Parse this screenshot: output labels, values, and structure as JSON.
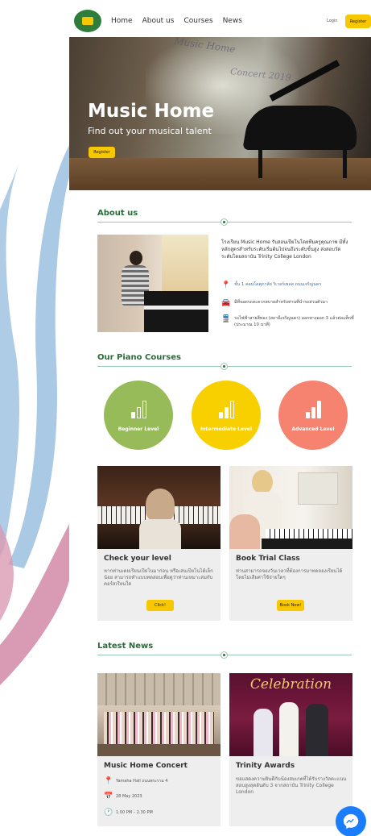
{
  "header": {
    "nav": [
      "Home",
      "About us",
      "Courses",
      "News"
    ],
    "login": "Login",
    "register": "Register"
  },
  "hero": {
    "title": "Music Home",
    "subtitle": "Find out your musical talent",
    "button": "Register",
    "script_text_1": "Music Home",
    "script_text_2": "Concert 2019"
  },
  "about": {
    "title": "About us",
    "description": "โรงเรียน Music Home รับสอนเปียโนโดยทีมครูคุณภาพ มีทั้งหลักสูตรสำหรับระดับเริ่มต้นไปจนถึงระดับขั้นสูง ส่งสอบวัดระดับโดยสถาบัน Trinity College London",
    "items": [
      {
        "icon": "location-pin-icon",
        "text": "ชั้น 1 คอนโดศุภาลัย ริเวอร์เพลส ถนนเจริญนคร"
      },
      {
        "icon": "car-icon",
        "text": "มีที่จอดรถสะดวกสบายสำหรับท่านที่นำรถส่วนตัวมา"
      },
      {
        "icon": "train-icon",
        "text": "รถไฟฟ้าสายสีทอง (สถานีเจริญนคร) ออกทางออก 3 แล้วต่อแท็กซี่ (ประมาณ 10 นาที)"
      }
    ]
  },
  "courses": {
    "title": "Our Piano Courses",
    "levels": [
      {
        "label": "Beginner Level",
        "color": "#98bb5a"
      },
      {
        "label": "Intermediate Level",
        "color": "#f8d000"
      },
      {
        "label": "Advanced Level",
        "color": "#f58370"
      }
    ],
    "cards": [
      {
        "title": "Check your level",
        "text": "หากท่านเคยเรียนเปียโนมาก่อน หรือเล่นเปียโนได้เล็กน้อย สามารถทำแบบทดสอบเพื่อดูว่าท่านเหมาะสมกับคอร์สเรียนใด",
        "button": "Click!"
      },
      {
        "title": "Book Trial Class",
        "text": "ท่านสามารถจองวันเวลาที่ต้องการมาทดลองเรียนได้โดยไม่เสียค่าใช้จ่ายใดๆ",
        "button": "Book Now!"
      }
    ]
  },
  "news": {
    "title": "Latest News",
    "items": [
      {
        "title": "Music Home Concert",
        "location": "Yamaha Hall ถนนพระราม 4",
        "date": "28 May 2023",
        "time": "1.00 PM – 2.30 PM"
      },
      {
        "title": "Trinity Awards",
        "text": "ขอแสดงความยินดีกับน้องสมเกตที่ได้รับรางวัลคะแนนสอบสูงสุดอันดับ 3 จากสถาบัน Trinity College London",
        "banner": "Celebration"
      }
    ]
  },
  "colors": {
    "accent": "#f7c700",
    "heading": "#2b6b3a",
    "ribbon_blue": "#aac9e4",
    "ribbon_pink": "#d99ab3"
  }
}
